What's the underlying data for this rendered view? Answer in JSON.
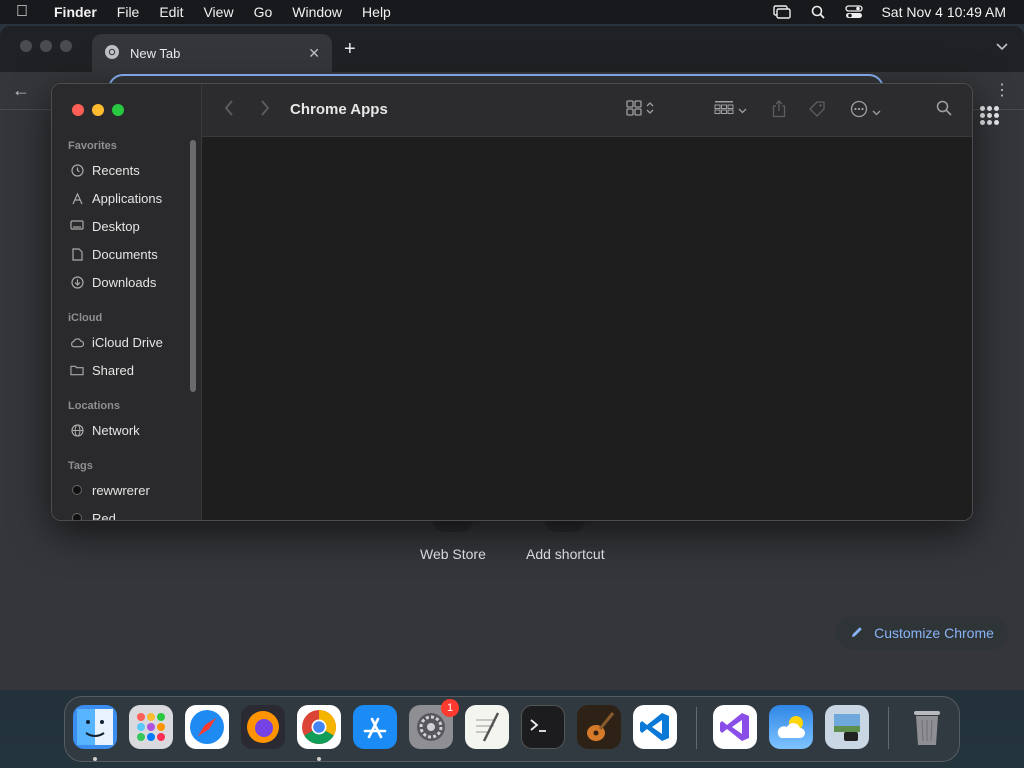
{
  "menubar": {
    "app": "Finder",
    "items": [
      "File",
      "Edit",
      "View",
      "Go",
      "Window",
      "Help"
    ],
    "datetime": "Sat Nov 4  10:49 AM"
  },
  "chrome": {
    "tab_title": "New Tab",
    "shortcuts": [
      "Web Store",
      "Add shortcut"
    ],
    "customize_label": "Customize Chrome"
  },
  "finder": {
    "title": "Chrome Apps",
    "sections": {
      "favorites": "Favorites",
      "icloud": "iCloud",
      "locations": "Locations",
      "tags": "Tags"
    },
    "favorites": [
      "Recents",
      "Applications",
      "Desktop",
      "Documents",
      "Downloads"
    ],
    "icloud": [
      "iCloud Drive",
      "Shared"
    ],
    "locations": [
      "Network"
    ],
    "tags": [
      "rewwrerer",
      "Red"
    ]
  },
  "dock": {
    "settings_badge": "1"
  },
  "colors": {
    "accent_blue": "#8ab4f8",
    "traffic_red": "#ff5f57",
    "traffic_yellow": "#febc2e",
    "traffic_green": "#28c840"
  }
}
